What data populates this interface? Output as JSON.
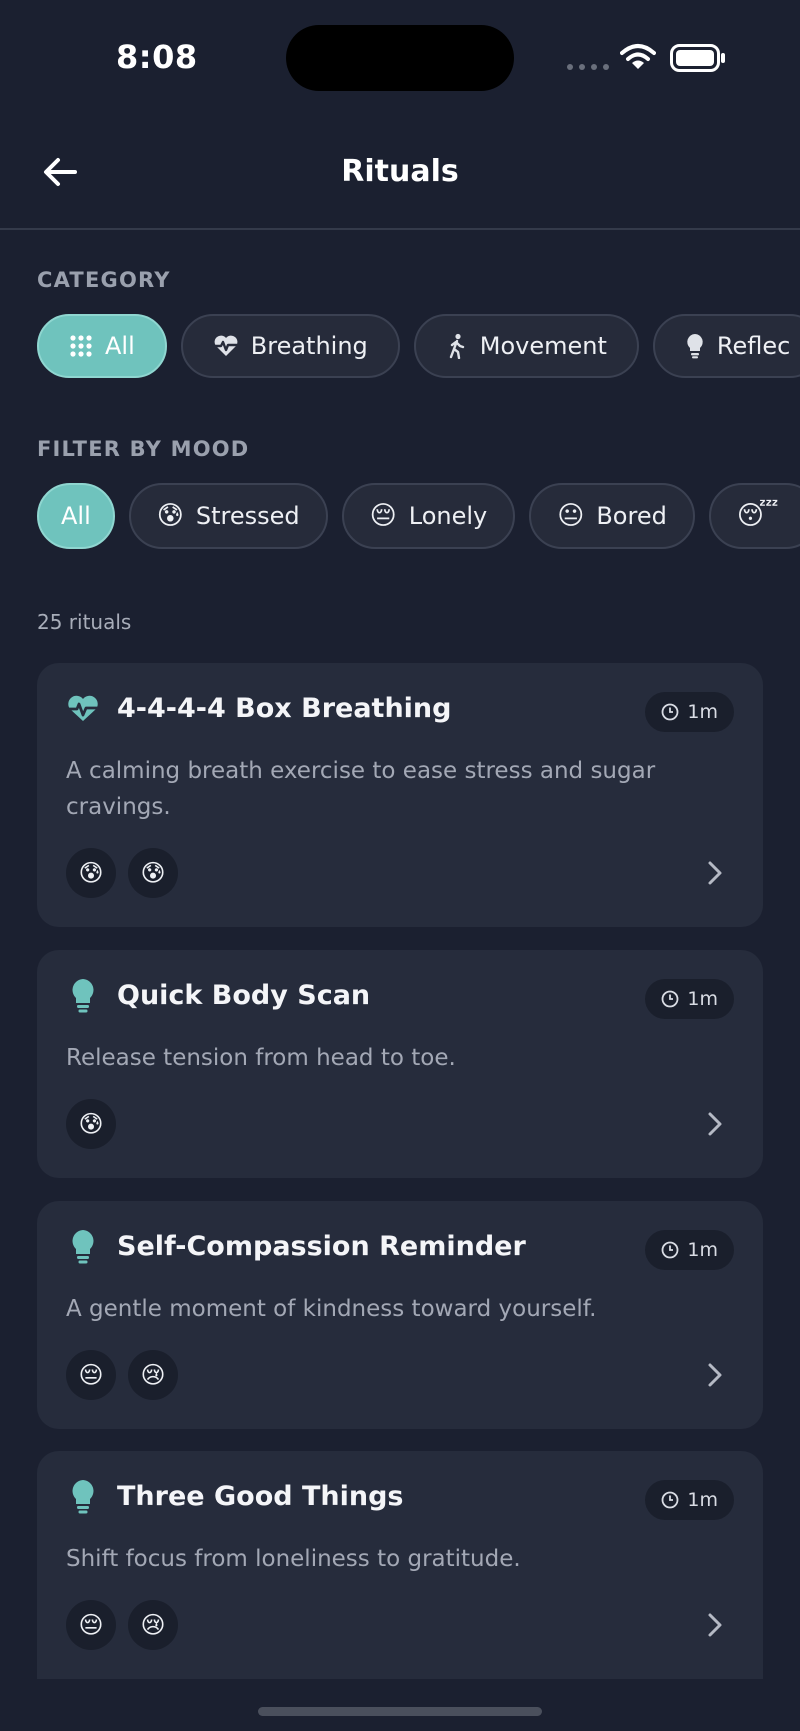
{
  "status_bar": {
    "time": "8:08"
  },
  "header": {
    "title": "Rituals"
  },
  "category": {
    "label": "CATEGORY",
    "chips": [
      {
        "label": "All",
        "icon": "grid-icon",
        "active": true
      },
      {
        "label": "Breathing",
        "icon": "heart-pulse-icon",
        "active": false
      },
      {
        "label": "Movement",
        "icon": "walking-icon",
        "active": false
      },
      {
        "label": "Reflec",
        "icon": "lightbulb-icon",
        "active": false
      }
    ]
  },
  "mood_filter": {
    "label": "FILTER BY MOOD",
    "chips": [
      {
        "label": "All",
        "emoji": "",
        "active": true
      },
      {
        "label": "Stressed",
        "emoji": "😰",
        "active": false
      },
      {
        "label": "Lonely",
        "emoji": "😔",
        "active": false
      },
      {
        "label": "Bored",
        "emoji": "😐",
        "active": false
      },
      {
        "label": "",
        "emoji": "😴",
        "active": false
      }
    ]
  },
  "results": {
    "count_text": "25 rituals"
  },
  "rituals": [
    {
      "title": "4-4-4-4 Box Breathing",
      "duration": "1m",
      "icon": "heart-pulse-icon",
      "description": "A calming breath exercise to ease stress and sugar cravings.",
      "moods": [
        "😰",
        "😰"
      ]
    },
    {
      "title": "Quick Body Scan",
      "duration": "1m",
      "icon": "lightbulb-icon",
      "description": "Release tension from head to toe.",
      "moods": [
        "😰"
      ]
    },
    {
      "title": "Self-Compassion Reminder",
      "duration": "1m",
      "icon": "lightbulb-icon",
      "description": "A gentle moment of kindness toward yourself.",
      "moods": [
        "😔",
        "😢"
      ]
    },
    {
      "title": "Three Good Things",
      "duration": "1m",
      "icon": "lightbulb-icon",
      "description": "Shift focus from loneliness to gratitude.",
      "moods": [
        "😔",
        "😢"
      ]
    }
  ],
  "colors": {
    "background": "#1b2030",
    "card": "#262c3c",
    "accent": "#6fc3bd",
    "chip": "#262b3a"
  }
}
